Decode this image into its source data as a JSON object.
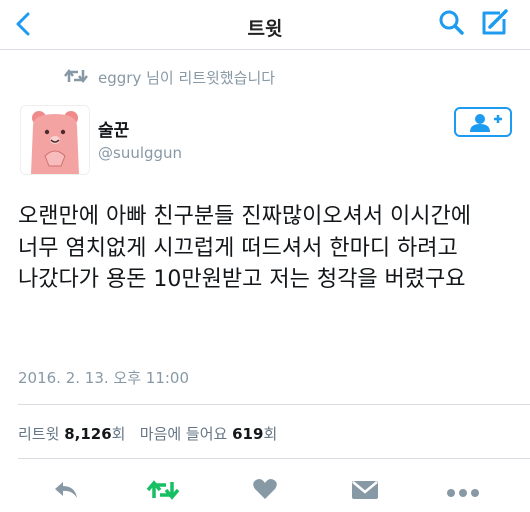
{
  "header": {
    "title": "트윗"
  },
  "retweet_notice": {
    "text": "eggry 님이 리트윗했습니다"
  },
  "author": {
    "name": "술꾼",
    "handle": "@suulggun"
  },
  "tweet": {
    "text": "오랜만에 아빠 친구분들 진짜많이오셔서 이시간에 너무 염치없게 시끄럽게 떠드셔서 한마디 하려고 나갔다가 용돈 10만원받고 저는 청각을 버렸구요",
    "date": "2016. 2. 13. 오후 11:00"
  },
  "stats": {
    "retweet_label": "리트윗",
    "retweet_count": "8,126",
    "retweet_unit": "회",
    "like_label": "마음에 들어요",
    "like_count": "619",
    "like_unit": "회"
  },
  "colors": {
    "accent": "#1d9bf0",
    "retweet_green": "#17bf63",
    "muted": "#8899a6"
  },
  "icons": [
    "back-icon",
    "search-icon",
    "compose-icon",
    "retweet-icon",
    "follow-icon",
    "reply-icon",
    "heart-icon",
    "message-icon",
    "more-icon"
  ]
}
